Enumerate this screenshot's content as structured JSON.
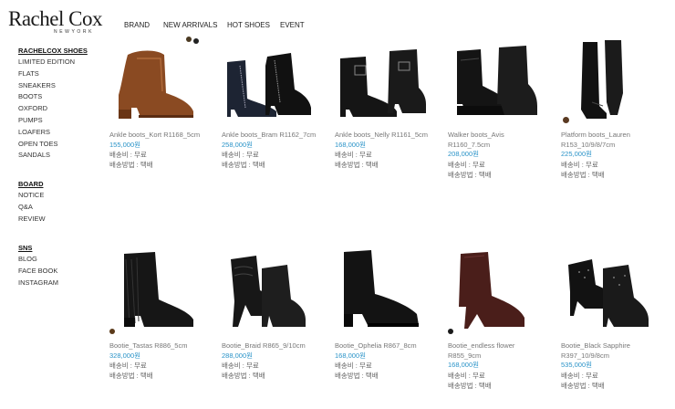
{
  "brand": {
    "name": "Rachel Cox",
    "sub": "NEWYORK"
  },
  "topnav": [
    "BRAND",
    "NEW ARRIVALS",
    "HOT SHOES",
    "EVENT"
  ],
  "sidebar": {
    "shoes": {
      "head": "RACHELCOX SHOES",
      "items": [
        "LIMITED EDITION",
        "FLATS",
        "SNEAKERS",
        "BOOTS",
        "OXFORD",
        "PUMPS",
        "LOAFERS",
        "OPEN TOES",
        "SANDALS"
      ]
    },
    "board": {
      "head": "BOARD",
      "items": [
        "NOTICE",
        "Q&A",
        "REVIEW"
      ]
    },
    "sns": {
      "head": "SNS",
      "items": [
        "BLOG",
        "FACE BOOK",
        "INSTAGRAM"
      ]
    }
  },
  "products": [
    {
      "name": [
        "Ankle boots_Kort R1168_5cm"
      ],
      "price": "155,000원",
      "ship_fee": "배송비 : 무료",
      "ship_method": "배송방법 : 택배",
      "icon": "brown-ankle-boot-icon",
      "color": "#8a4a22"
    },
    {
      "name": [
        "Ankle boots_Bram R1162_7cm"
      ],
      "price": "258,000원",
      "ship_fee": "배송비 : 무료",
      "ship_method": "배송방법 : 택배",
      "icon": "navy-zip-ankle-boot-icon",
      "color": "#1d2433"
    },
    {
      "name": [
        "Ankle boots_Nelly R1161_5cm"
      ],
      "price": "168,000원",
      "ship_fee": "배송비 : 무료",
      "ship_method": "배송방법 : 택배",
      "icon": "black-buckle-ankle-boot-icon",
      "color": "#151515"
    },
    {
      "name": [
        "Walker boots_Avis",
        "R1160_7.5cm"
      ],
      "price": "208,000원",
      "ship_fee": "배송비 : 무료",
      "ship_method": "배송방법 : 택배",
      "icon": "black-walker-boot-icon",
      "color": "#141414"
    },
    {
      "name": [
        "Platform boots_Lauren",
        "R153_10/9/8/7cm"
      ],
      "price": "225,000원",
      "ship_fee": "배송비 : 무료",
      "ship_method": "배송방법 : 택배",
      "icon": "black-tall-platform-boot-icon",
      "color": "#121212"
    },
    {
      "name": [
        "Bootie_Tastas R886_5cm"
      ],
      "price": "328,000원",
      "ship_fee": "배송비 : 무료",
      "ship_method": "배송방법 : 택배",
      "icon": "black-fringe-bootie-icon",
      "color": "#161616"
    },
    {
      "name": [
        "Bootie_Braid R865_9/10cm"
      ],
      "price": "288,000원",
      "ship_fee": "배송비 : 무료",
      "ship_method": "배송방법 : 택배",
      "icon": "black-braid-bootie-icon",
      "color": "#171717"
    },
    {
      "name": [
        "Bootie_Ophelia R867_8cm"
      ],
      "price": "168,000원",
      "ship_fee": "배송비 : 무료",
      "ship_method": "배송방법 : 택배",
      "icon": "black-ophelia-bootie-icon",
      "color": "#131313"
    },
    {
      "name": [
        "Bootie_endless flower",
        "R855_9cm"
      ],
      "price": "168,000원",
      "ship_fee": "배송비 : 무료",
      "ship_method": "배송방법 : 택배",
      "icon": "brown-flower-bootie-icon",
      "color": "#4a1e1a"
    },
    {
      "name": [
        "Bootie_Black Sapphire",
        "R397_10/9/8cm"
      ],
      "price": "535,000원",
      "ship_fee": "배송비 : 무료",
      "ship_method": "배송방법 : 택배",
      "icon": "black-sapphire-bootie-icon",
      "color": "#121212"
    }
  ]
}
